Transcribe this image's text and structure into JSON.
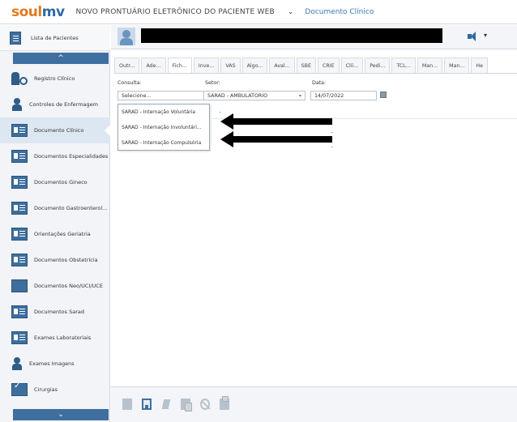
{
  "header": {
    "logo_part1": "soul",
    "logo_part2": "mv",
    "app_title": "NOVO PRONTUÁRIO ELETRÔNICO DO PACIENTE WEB",
    "dropdown_glyph": "⌄",
    "breadcrumb": "Documento Clínico"
  },
  "sidebar": {
    "patient_list_label": "Lista de Pacientes",
    "scroll_up": "^",
    "scroll_down": "⌄",
    "items": [
      {
        "label": "Registro Clínico",
        "icon": "person-search-icon"
      },
      {
        "label": "Controles de Enfermagem",
        "icon": "person-icon"
      },
      {
        "label": "Documento Clínico",
        "icon": "document-icon",
        "active": true
      },
      {
        "label": "Documentos Especialidades",
        "icon": "document-icon"
      },
      {
        "label": "Documentos Gineco",
        "icon": "document-icon"
      },
      {
        "label": "Documento Gastroenterol...",
        "icon": "document-icon"
      },
      {
        "label": "Orientações Geriatria",
        "icon": "document-icon"
      },
      {
        "label": "Documentos Obstetrícia",
        "icon": "document-icon"
      },
      {
        "label": "Documentos Neo/UCI/UCE",
        "icon": "monitor-icon"
      },
      {
        "label": "Documentos Sarad",
        "icon": "document-icon"
      },
      {
        "label": "Exames Laboratoriais",
        "icon": "document-icon"
      },
      {
        "label": "Exames Imagens",
        "icon": "person-icon"
      },
      {
        "label": "Cirurgias",
        "icon": "surgery-icon"
      }
    ]
  },
  "patient_bar": {
    "sound_dropdown": "▾"
  },
  "tabs": [
    "Outr...",
    "Ade...",
    "Fich...",
    "Inve...",
    "VAS",
    "Algo...",
    "Aval...",
    "SBE",
    "CRIE",
    "Clíi...",
    "Pedi...",
    "TCL...",
    "Man...",
    "Man...",
    "He"
  ],
  "form": {
    "consulta_label": "Consulta:",
    "consulta_value": "Selecione...",
    "setor_label": "Setor:",
    "setor_value": "SARAD - AMBULATORIO",
    "data_label": "Data:",
    "data_value": "14/07/2022",
    "dropdown_arrow": "▾",
    "dropdown_options": [
      "SARAD - Internação Voluntária",
      "SARAD - Internação Involuntári...",
      "SARAD - Internação Compulsória"
    ]
  },
  "toolbar": {
    "icons": [
      "new-document-icon",
      "save-icon",
      "sign-icon",
      "copy-icon",
      "cancel-icon",
      "print-icon"
    ]
  },
  "colors": {
    "brand_orange": "#e07b1f",
    "brand_blue": "#2e6aa6",
    "sidebar_bg": "#f2f4f7",
    "accent": "#3f6f9f"
  }
}
